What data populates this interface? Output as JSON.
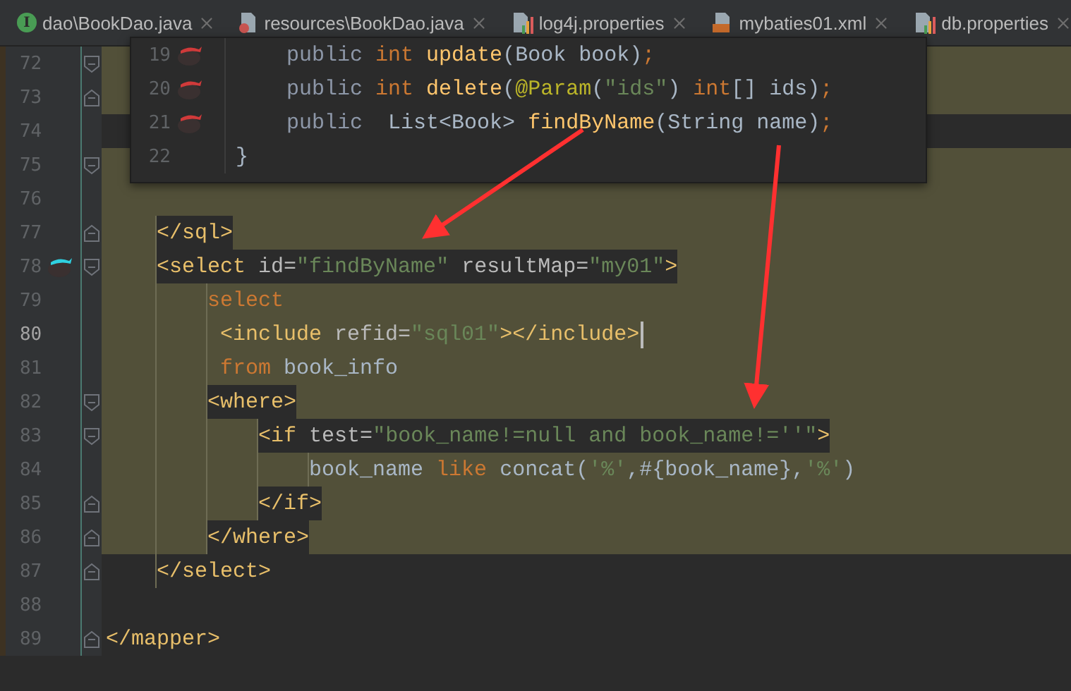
{
  "tabs": [
    {
      "label": "dao\\BookDao.java",
      "kind": "interface",
      "badge": "I"
    },
    {
      "label": "resources\\BookDao.java",
      "kind": "java"
    },
    {
      "label": "log4j.properties",
      "kind": "properties"
    },
    {
      "label": "mybaties01.xml",
      "kind": "xml"
    },
    {
      "label": "db.properties",
      "kind": "properties"
    }
  ],
  "editor": {
    "lines": [
      {
        "number": "72",
        "highlighted": true,
        "fold_open": true
      },
      {
        "number": "73",
        "highlighted": true,
        "fold_close": true
      },
      {
        "number": "74",
        "highlighted": false
      },
      {
        "number": "75",
        "highlighted": true,
        "fold_open": true
      },
      {
        "number": "76",
        "highlighted": true
      },
      {
        "number": "77",
        "highlighted": true,
        "boxed": true,
        "fold_close": true,
        "segments": [
          {
            "text": "    </sql>",
            "kind": "tag"
          }
        ]
      },
      {
        "number": "78",
        "highlighted": true,
        "boxed": true,
        "fold_open": true,
        "mapper_icon": true,
        "segments": [
          {
            "text": "    <select ",
            "kind": "tag"
          },
          {
            "text": "id=",
            "kind": "attr"
          },
          {
            "text": "\"findByName\"",
            "kind": "string"
          },
          {
            "text": " resultMap=",
            "kind": "attr"
          },
          {
            "text": "\"my01\"",
            "kind": "string"
          },
          {
            "text": ">",
            "kind": "tag"
          }
        ]
      },
      {
        "number": "79",
        "highlighted": true,
        "segments": [
          {
            "text": "        select",
            "kind": "keyword"
          }
        ]
      },
      {
        "number": "80",
        "highlighted": true,
        "current": true,
        "segments": [
          {
            "text": "         <include ",
            "kind": "tag"
          },
          {
            "text": "refid=",
            "kind": "attr"
          },
          {
            "text": "\"sql01\"",
            "kind": "string"
          },
          {
            "text": "></include>",
            "kind": "tag"
          }
        ]
      },
      {
        "number": "81",
        "highlighted": true,
        "segments": [
          {
            "text": "         from ",
            "kind": "keyword"
          },
          {
            "text": "book_info",
            "kind": "ident"
          }
        ]
      },
      {
        "number": "82",
        "highlighted": true,
        "boxed": true,
        "fold_open": true,
        "segments": [
          {
            "text": "        <where>",
            "kind": "tag"
          }
        ]
      },
      {
        "number": "83",
        "highlighted": true,
        "boxed": true,
        "fold_open": true,
        "segments": [
          {
            "text": "            <if ",
            "kind": "tag"
          },
          {
            "text": "test=",
            "kind": "attr"
          },
          {
            "text": "\"book_name!=null and book_name!=''\"",
            "kind": "string"
          },
          {
            "text": ">",
            "kind": "tag"
          }
        ]
      },
      {
        "number": "84",
        "highlighted": true,
        "segments": [
          {
            "text": "                book_name ",
            "kind": "ident"
          },
          {
            "text": "like ",
            "kind": "keyword"
          },
          {
            "text": "concat(",
            "kind": "ident"
          },
          {
            "text": "'%'",
            "kind": "string"
          },
          {
            "text": ",#{book_name},",
            "kind": "ident"
          },
          {
            "text": "'%'",
            "kind": "string"
          },
          {
            "text": ")",
            "kind": "ident"
          }
        ]
      },
      {
        "number": "85",
        "highlighted": true,
        "boxed": true,
        "fold_close": true,
        "segments": [
          {
            "text": "            </if>",
            "kind": "tag"
          }
        ]
      },
      {
        "number": "86",
        "highlighted": true,
        "boxed": true,
        "fold_close": true,
        "segments": [
          {
            "text": "        </where>",
            "kind": "tag"
          }
        ]
      },
      {
        "number": "87",
        "highlighted": false,
        "boxed": true,
        "fold_close": true,
        "segments": [
          {
            "text": "    </select>",
            "kind": "tag"
          }
        ]
      },
      {
        "number": "88",
        "highlighted": false
      },
      {
        "number": "89",
        "highlighted": false,
        "fold_close": true,
        "segments": [
          {
            "text": "</mapper>",
            "kind": "tag"
          }
        ]
      }
    ]
  },
  "popup": {
    "lines": [
      {
        "number": "19",
        "mapper_icon": true,
        "segments": [
          {
            "text": "    public ",
            "kind": "modifier"
          },
          {
            "text": "int ",
            "kind": "keyword"
          },
          {
            "text": "update",
            "kind": "method"
          },
          {
            "text": "(Book book)",
            "kind": "ident"
          },
          {
            "text": ";",
            "kind": "keyword"
          }
        ]
      },
      {
        "number": "20",
        "mapper_icon": true,
        "segments": [
          {
            "text": "    public ",
            "kind": "modifier"
          },
          {
            "text": "int ",
            "kind": "keyword"
          },
          {
            "text": "delete",
            "kind": "method"
          },
          {
            "text": "(",
            "kind": "ident"
          },
          {
            "text": "@Param",
            "kind": "annotation"
          },
          {
            "text": "(",
            "kind": "ident"
          },
          {
            "text": "\"ids\"",
            "kind": "string"
          },
          {
            "text": ") ",
            "kind": "ident"
          },
          {
            "text": "int",
            "kind": "keyword"
          },
          {
            "text": "[] ids)",
            "kind": "ident"
          },
          {
            "text": ";",
            "kind": "keyword"
          }
        ]
      },
      {
        "number": "21",
        "mapper_icon": true,
        "segments": [
          {
            "text": "    public ",
            "kind": "modifier"
          },
          {
            "text": " List<Book> ",
            "kind": "ident"
          },
          {
            "text": "findByName",
            "kind": "method"
          },
          {
            "text": "(String name)",
            "kind": "ident"
          },
          {
            "text": ";",
            "kind": "keyword"
          }
        ]
      },
      {
        "number": "22",
        "segments": [
          {
            "text": "}",
            "kind": "ident"
          }
        ]
      }
    ]
  }
}
